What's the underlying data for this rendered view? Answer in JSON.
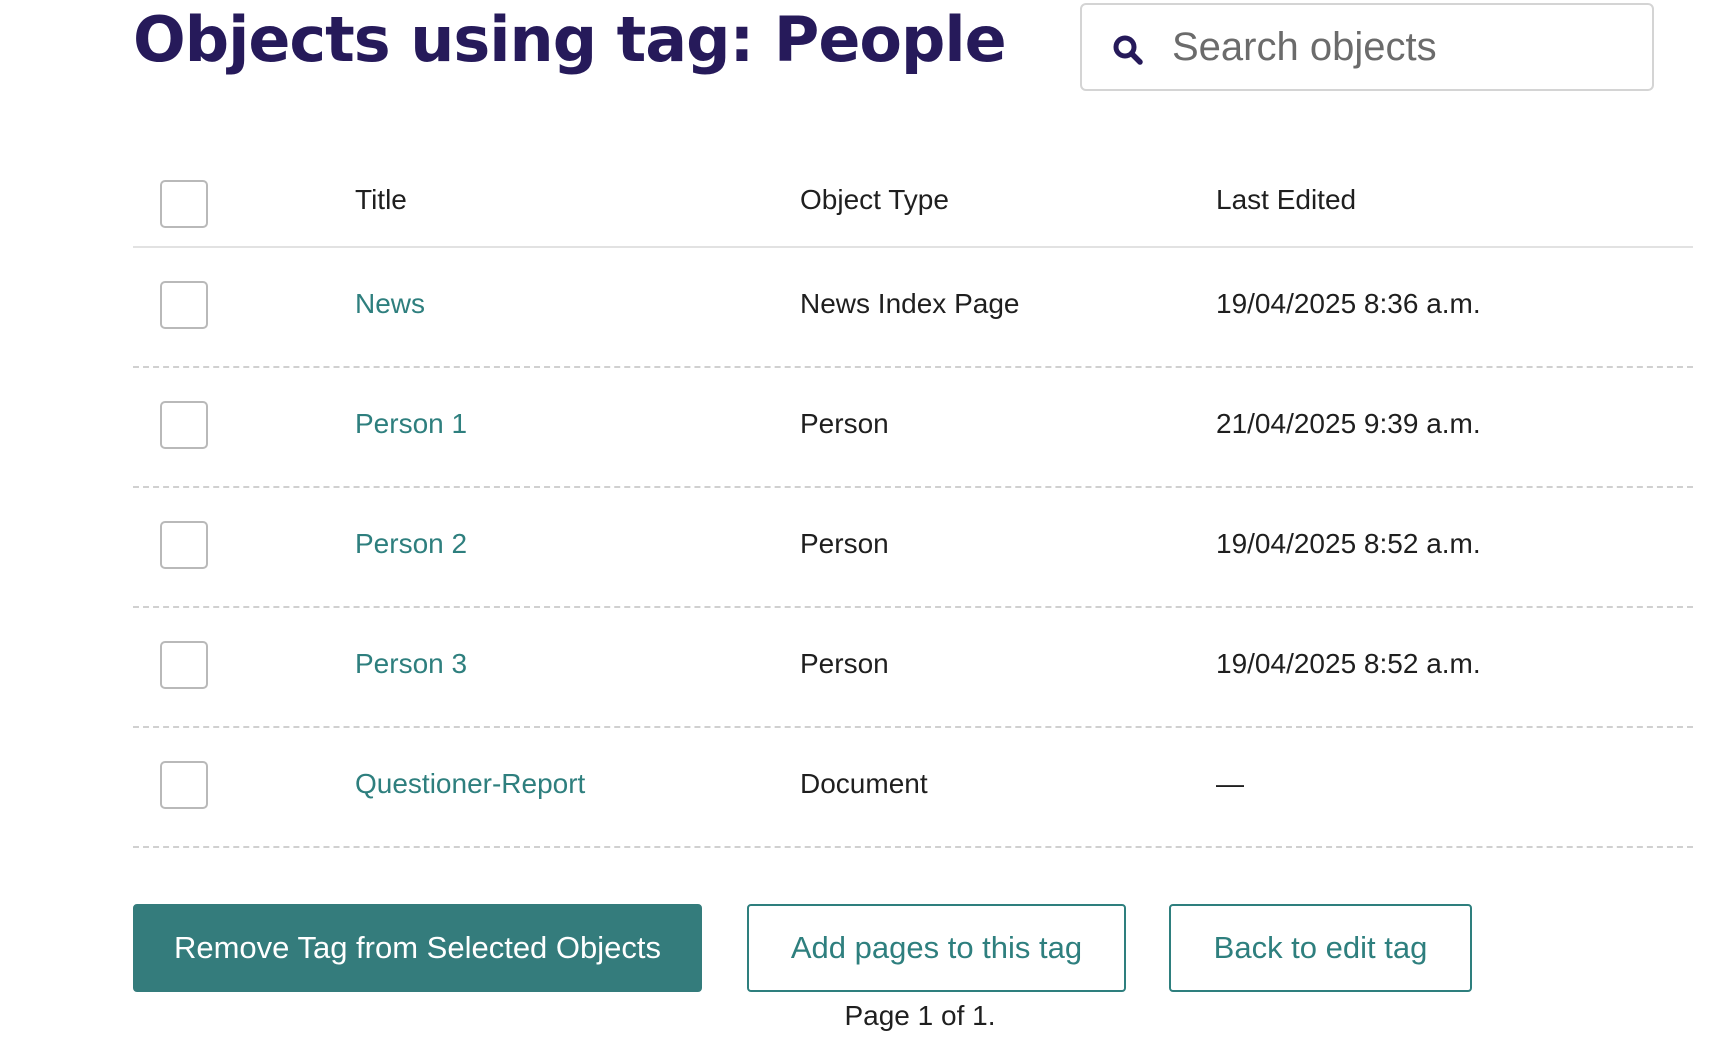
{
  "header": {
    "title": "Objects using tag: People"
  },
  "search": {
    "placeholder": "Search objects",
    "value": ""
  },
  "table": {
    "columns": {
      "title": "Title",
      "object_type": "Object Type",
      "last_edited": "Last Edited"
    },
    "rows": [
      {
        "title": "News",
        "object_type": "News Index Page",
        "last_edited": "19/04/2025 8:36 a.m."
      },
      {
        "title": "Person 1",
        "object_type": "Person",
        "last_edited": "21/04/2025 9:39 a.m."
      },
      {
        "title": "Person 2",
        "object_type": "Person",
        "last_edited": "19/04/2025 8:52 a.m."
      },
      {
        "title": "Person 3",
        "object_type": "Person",
        "last_edited": "19/04/2025 8:52 a.m."
      },
      {
        "title": "Questioner-Report",
        "object_type": "Document",
        "last_edited": "—"
      }
    ]
  },
  "actions": {
    "remove_label": "Remove Tag from Selected Objects",
    "add_pages_label": "Add pages to this tag",
    "back_label": "Back to edit tag"
  },
  "pagination": {
    "text": "Page 1 of 1."
  },
  "colors": {
    "title": "#261a5a",
    "link": "#2e7f7e",
    "primary_button": "#347c7c"
  },
  "icons": {
    "search": "search-icon"
  }
}
